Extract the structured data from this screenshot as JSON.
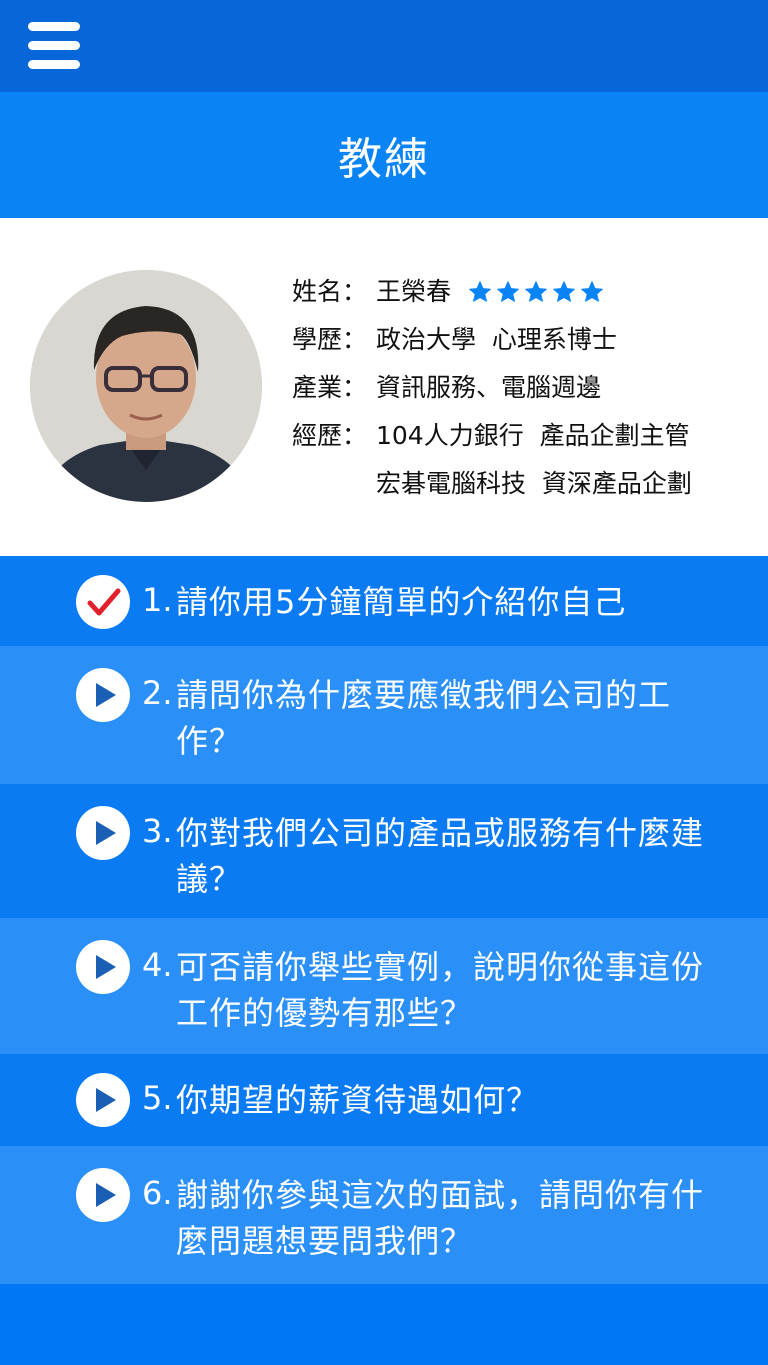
{
  "header": {
    "menu_icon": "hamburger-menu-icon",
    "title": "教練"
  },
  "profile": {
    "name_label": "姓名：",
    "name": "王榮春",
    "rating": 5,
    "rating_max": 5,
    "star_color": "#0a84f5",
    "education_label": "學歷：",
    "education": "政治大學  心理系博士",
    "industry_label": "產業：",
    "industry": "資訊服務、電腦週邊",
    "experience_label": "經歷：",
    "experience": [
      "104人力銀行  產品企劃主管",
      "宏碁電腦科技  資深產品企劃"
    ]
  },
  "questions": [
    {
      "num": "1.",
      "text": "請你用5分鐘簡單的介紹你自己",
      "status": "done",
      "icon": "check-icon"
    },
    {
      "num": "2.",
      "text": "請問你為什麼要應徵我們公司的工作？",
      "status": "play",
      "icon": "play-icon"
    },
    {
      "num": "3.",
      "text": "你對我們公司的產品或服務有什麼建議？",
      "status": "play",
      "icon": "play-icon"
    },
    {
      "num": "4.",
      "text": "可否請你舉些實例，說明你從事這份工作的優勢有那些？",
      "status": "play",
      "icon": "play-icon"
    },
    {
      "num": "5.",
      "text": "你期望的薪資待遇如何？",
      "status": "play",
      "icon": "play-icon"
    },
    {
      "num": "6.",
      "text": "謝謝你參與這次的面試，請問你有什麼問題想要問我們？",
      "status": "play",
      "icon": "play-icon"
    }
  ],
  "colors": {
    "topbar": "#0766d8",
    "title_bg": "#0a84f5",
    "row_dark": "#0a7bf3",
    "row_light": "#2a8ff7",
    "check": "#e0202a",
    "play": "#1a5fb4"
  }
}
